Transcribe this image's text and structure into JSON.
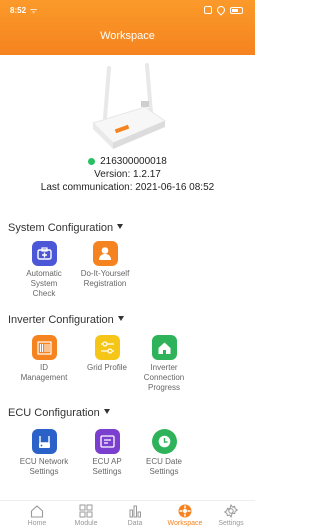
{
  "status": {
    "time": "8:52",
    "carrier_glyph": "ᯤ"
  },
  "header": {
    "title": "Workspace"
  },
  "device": {
    "serial": "216300000018",
    "version": "Version: 1.2.17",
    "last_comm": "Last communication: 2021-06-16 08:52",
    "online_color": "#29c062"
  },
  "sections": {
    "system": {
      "title": "System Configuration",
      "items": [
        {
          "label": "Automatic System Check",
          "icon": "medical-kit-icon",
          "color": "#4b57d6"
        },
        {
          "label": "Do-It-Yourself Registration",
          "icon": "user-icon",
          "color": "#f5831f"
        }
      ]
    },
    "inverter": {
      "title": "Inverter Configuration",
      "items": [
        {
          "label": "ID Management",
          "icon": "barcode-icon",
          "color": "#f5831f"
        },
        {
          "label": "Grid Profile",
          "icon": "sliders-icon",
          "color": "#f5c518"
        },
        {
          "label": "Inverter Connection Progress",
          "icon": "house-icon",
          "color": "#2fb35a"
        }
      ]
    },
    "ecu": {
      "title": "ECU Configuration",
      "items": [
        {
          "label": "ECU Network Settings",
          "icon": "network-icon",
          "color": "#2a62c9"
        },
        {
          "label": "ECU AP Settings",
          "icon": "ap-icon",
          "color": "#7a3fcf"
        },
        {
          "label": "ECU Date Settings",
          "icon": "clock-icon",
          "color": "#2fb35a"
        }
      ]
    }
  },
  "tabs": [
    {
      "label": "Home",
      "icon": "home-icon"
    },
    {
      "label": "Module",
      "icon": "grid-icon"
    },
    {
      "label": "Data",
      "icon": "bar-chart-icon"
    },
    {
      "label": "Workspace",
      "icon": "workspace-icon",
      "active": true
    },
    {
      "label": "Settings",
      "icon": "gear-icon"
    }
  ]
}
